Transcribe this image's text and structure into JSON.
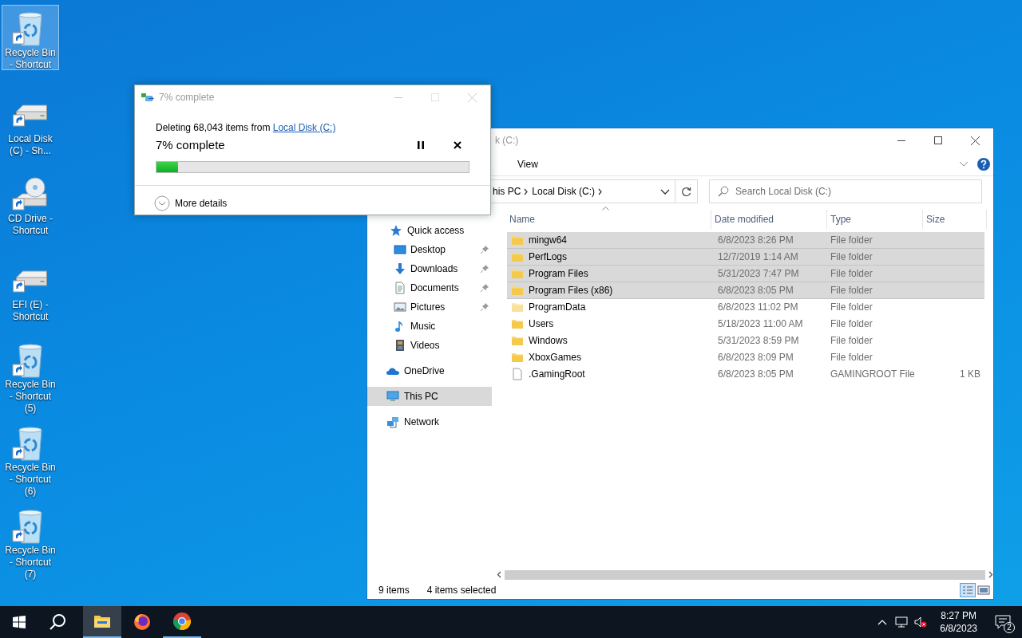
{
  "desktop_icons": [
    {
      "label": "Recycle Bin - Shortcut",
      "kind": "recycle",
      "selected": true
    },
    {
      "label": "Local Disk (C) - Sh...",
      "kind": "drive",
      "selected": false
    },
    {
      "label": "CD Drive - Shortcut",
      "kind": "cd",
      "selected": false
    },
    {
      "label": "EFI (E) - Shortcut",
      "kind": "drive",
      "selected": false
    },
    {
      "label": "Recycle Bin - Shortcut (5)",
      "kind": "recycle",
      "selected": false
    },
    {
      "label": "Recycle Bin - Shortcut (6)",
      "kind": "recycle",
      "selected": false
    },
    {
      "label": "Recycle Bin - Shortcut (7)",
      "kind": "recycle",
      "selected": false
    }
  ],
  "explorer": {
    "title": "k (C:)",
    "ribbon_tabs": [
      "View"
    ],
    "address": [
      "his PC",
      "Local Disk (C:)"
    ],
    "search": {
      "placeholder": "Search Local Disk (C:)"
    },
    "nav": [
      {
        "label": "Quick access",
        "kind": "star",
        "selected": false,
        "children": [
          {
            "label": "Desktop",
            "kind": "desktop",
            "pinned": true,
            "selected": false
          },
          {
            "label": "Downloads",
            "kind": "downloads",
            "pinned": true,
            "selected": false
          },
          {
            "label": "Documents",
            "kind": "documents",
            "pinned": true,
            "selected": false
          },
          {
            "label": "Pictures",
            "kind": "pictures",
            "pinned": true,
            "selected": false
          },
          {
            "label": "Music",
            "kind": "music",
            "pinned": false,
            "selected": false
          },
          {
            "label": "Videos",
            "kind": "videos",
            "pinned": false,
            "selected": false
          }
        ]
      },
      {
        "label": "OneDrive",
        "kind": "cloud",
        "selected": false
      },
      {
        "label": "This PC",
        "kind": "pc",
        "selected": true
      },
      {
        "label": "Network",
        "kind": "network",
        "selected": false
      }
    ],
    "columns": [
      "Name",
      "Date modified",
      "Type",
      "Size"
    ],
    "files": [
      {
        "name": "mingw64",
        "kind": "folder",
        "date": "6/8/2023 8:26 PM",
        "type": "File folder",
        "selected": true
      },
      {
        "name": "PerfLogs",
        "kind": "folder",
        "date": "12/7/2019 1:14 AM",
        "type": "File folder",
        "selected": true
      },
      {
        "name": "Program Files",
        "kind": "folder",
        "date": "5/31/2023 7:47 PM",
        "type": "File folder",
        "selected": true
      },
      {
        "name": "Program Files (x86)",
        "kind": "folder",
        "date": "6/8/2023 8:05 PM",
        "type": "File folder",
        "selected": true
      },
      {
        "name": "ProgramData",
        "kind": "folder-hidden",
        "date": "6/8/2023 11:02 PM",
        "type": "File folder",
        "selected": false
      },
      {
        "name": "Users",
        "kind": "folder",
        "date": "5/18/2023 11:00 AM",
        "type": "File folder",
        "selected": false
      },
      {
        "name": "Windows",
        "kind": "folder",
        "date": "5/31/2023 8:59 PM",
        "type": "File folder",
        "selected": false
      },
      {
        "name": "XboxGames",
        "kind": "folder",
        "date": "6/8/2023 8:09 PM",
        "type": "File folder",
        "selected": false
      },
      {
        "name": ".GamingRoot",
        "kind": "file",
        "date": "6/8/2023 8:05 PM",
        "type": "GAMINGROOT File",
        "size": "1 KB",
        "selected": false
      }
    ],
    "status": {
      "count": "9 items",
      "selection": "4 items selected"
    }
  },
  "dialog": {
    "title": "7% complete",
    "message": "Deleting 68,043 items from ",
    "link": "Local Disk (C:)",
    "heading": "7% complete",
    "level": 0.07,
    "details": "More details"
  },
  "taskbar": {
    "apps": [
      {
        "kind": "explorer",
        "selected": true,
        "running": true
      },
      {
        "kind": "firefox",
        "selected": false,
        "running": false
      },
      {
        "kind": "chrome",
        "selected": false,
        "running": true
      }
    ],
    "volume_muted": true,
    "time": "8:27 PM",
    "date": "6/8/2023",
    "notifications": "2"
  }
}
